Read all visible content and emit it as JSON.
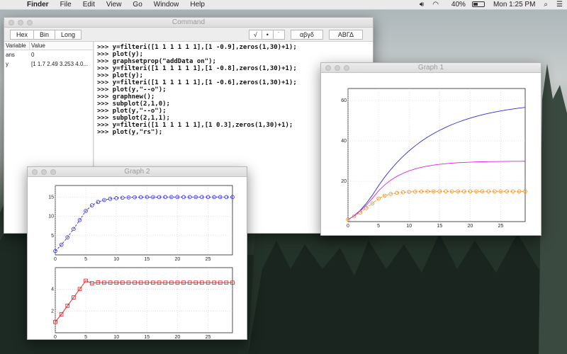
{
  "menubar": {
    "apple_icon": "apple-icon",
    "app_name": "Finder",
    "items": [
      "File",
      "Edit",
      "View",
      "Go",
      "Window",
      "Help"
    ],
    "battery": "40%",
    "clock": "Mon 1:25 PM"
  },
  "command_window": {
    "title": "Command",
    "toolbar": {
      "hex": "Hex",
      "bin": "Bin",
      "long": "Long",
      "sqrt": "√",
      "dot": "•",
      "prime": "˙",
      "greek_lower": "αβγδ",
      "greek_upper": "ΑΒΓΔ"
    },
    "variables": {
      "header_name": "Variable",
      "header_value": "Value",
      "rows": [
        {
          "name": "ans",
          "value": "0"
        },
        {
          "name": "y",
          "value": "[1 1.7 2.49 3.253 4.0..."
        }
      ]
    },
    "console_lines": [
      ">>> y=filteri([1 1 1 1 1 1],[1 -0.9],zeros(1,30)+1);",
      ">>> plot(y);",
      ">>> graphsetprop(\"addData on\");",
      ">>> y=filteri([1 1 1 1 1 1],[1 -0.8],zeros(1,30)+1);",
      ">>> plot(y);",
      ">>> y=filteri([1 1 1 1 1 1],[1 -0.6],zeros(1,30)+1);",
      ">>> plot(y,\"--o\");",
      ">>> graphnew();",
      ">>> subplot(2,1,0);",
      ">>> plot(y,\"--o\");",
      ">>> subplot(2,1,1);",
      ">>> y=filteri([1 1 1 1 1 1],[1 0.3],zeros(1,30)+1);",
      ">>> plot(y,\"rs\");"
    ]
  },
  "graph1": {
    "title": "Graph 1"
  },
  "graph2": {
    "title": "Graph 2"
  },
  "chart_data": [
    {
      "type": "line",
      "window": "Graph 1",
      "xlim": [
        0,
        29
      ],
      "ylim": [
        0,
        66
      ],
      "xticks": [
        0,
        5,
        10,
        15,
        20,
        25
      ],
      "yticks": [
        20,
        40,
        60
      ],
      "grid": true,
      "series": [
        {
          "style": "solid",
          "color": "#2b2bdc",
          "source_pole": 0.9,
          "n": 30
        },
        {
          "style": "solid",
          "color": "#e01ee0",
          "source_pole": 0.8,
          "n": 30
        },
        {
          "style": "dashed-circle",
          "color": "#f08a1c",
          "source_pole": 0.6,
          "n": 30
        }
      ]
    },
    {
      "type": "line",
      "window": "Graph 2 (top)",
      "xlim": [
        0,
        29
      ],
      "ylim": [
        0,
        18
      ],
      "xticks": [
        0,
        5,
        10,
        15,
        20,
        25
      ],
      "yticks": [
        5,
        10,
        15
      ],
      "grid": true,
      "series": [
        {
          "style": "dashed-circle",
          "color": "#2b2bdc",
          "source_pole": 0.6,
          "n": 30
        }
      ]
    },
    {
      "type": "scatter",
      "window": "Graph 2 (bottom)",
      "xlim": [
        0,
        29
      ],
      "ylim": [
        0,
        6
      ],
      "xticks": [
        0,
        5,
        10,
        15,
        20,
        25
      ],
      "yticks": [
        2,
        4
      ],
      "grid": true,
      "series": [
        {
          "style": "solid-square",
          "color": "#e02020",
          "source_pole": -0.3,
          "n": 30
        }
      ]
    }
  ],
  "colors": {
    "menubar_bg": "#ececec",
    "blue": "#2b2bdc",
    "magenta": "#e01ee0",
    "orange": "#f08a1c",
    "red": "#e02020"
  }
}
